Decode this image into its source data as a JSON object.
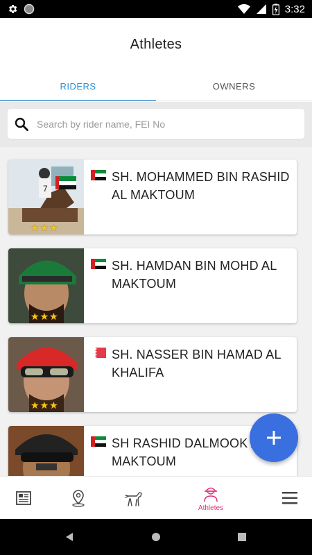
{
  "status_bar": {
    "time": "3:32"
  },
  "app_bar": {
    "title": "Athletes"
  },
  "tabs": [
    {
      "label": "RIDERS",
      "active": true
    },
    {
      "label": "OWNERS",
      "active": false
    }
  ],
  "search": {
    "placeholder": "Search by rider name, FEI No",
    "value": ""
  },
  "riders": [
    {
      "name": "SH. MOHAMMED BIN RASHID AL MAKTOUM",
      "flag": "uae-flag-icon",
      "stars": 3
    },
    {
      "name": "SH. HAMDAN BIN MOHD AL MAKTOUM",
      "flag": "uae-flag-icon",
      "stars": 3
    },
    {
      "name": "SH. NASSER BIN HAMAD AL KHALIFA",
      "flag": "bahrain-flag-icon",
      "stars": 3
    },
    {
      "name": "SH RASHID DALMOOK AL MAKTOUM",
      "flag": "uae-flag-icon",
      "stars": 3
    }
  ],
  "fab": {
    "icon": "plus-icon"
  },
  "bottom_nav": [
    {
      "icon": "news-icon",
      "label": "",
      "active": false
    },
    {
      "icon": "location-pin-icon",
      "label": "",
      "active": false
    },
    {
      "icon": "horse-icon",
      "label": "",
      "active": false
    },
    {
      "icon": "rider-icon",
      "label": "Athletes",
      "active": true
    },
    {
      "icon": "menu-icon",
      "label": "",
      "active": false
    }
  ],
  "colors": {
    "accent": "#2a8fd6",
    "fab": "#3a6fe0",
    "active_nav": "#e0307a",
    "star": "#f5c518"
  }
}
